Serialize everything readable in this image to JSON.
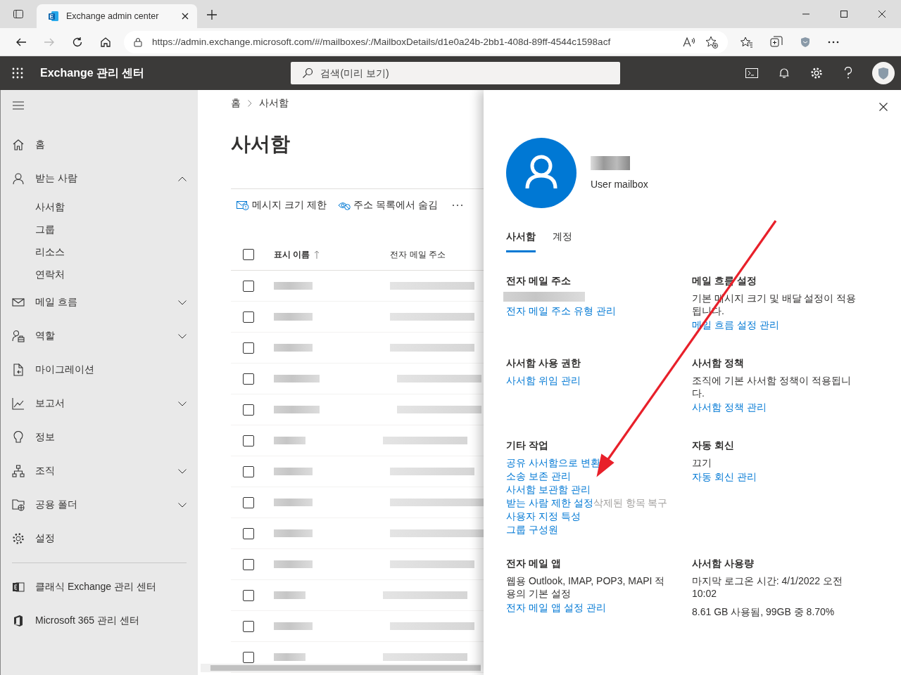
{
  "browser": {
    "tab_title": "Exchange admin center",
    "url": "https://admin.exchange.microsoft.com/#/mailboxes/:/MailboxDetails/d1e0a24b-2bb1-408d-89ff-4544c1598acf"
  },
  "header": {
    "title": "Exchange 관리 센터",
    "search": {
      "placeholder": "검색(미리 보기)"
    }
  },
  "sidebar": {
    "items": [
      {
        "label": "홈"
      },
      {
        "label": "받는 사람",
        "expanded": true,
        "children": [
          {
            "label": "사서함"
          },
          {
            "label": "그룹"
          },
          {
            "label": "리소스"
          },
          {
            "label": "연락처"
          }
        ]
      },
      {
        "label": "메일 흐름",
        "expanded": false
      },
      {
        "label": "역할",
        "expanded": false
      },
      {
        "label": "마이그레이션"
      },
      {
        "label": "보고서",
        "expanded": false
      },
      {
        "label": "정보"
      },
      {
        "label": "조직",
        "expanded": false
      },
      {
        "label": "공용 폴더",
        "expanded": false
      },
      {
        "label": "설정"
      }
    ],
    "footer": [
      {
        "label": "클래식 Exchange 관리 센터"
      },
      {
        "label": "Microsoft 365 관리 센터"
      }
    ]
  },
  "breadcrumb": [
    "홈",
    "사서함"
  ],
  "page_title": "사서함",
  "toolbar": [
    "메시지 크기 제한",
    "주소 목록에서 숨김"
  ],
  "table": {
    "columns": [
      "표시 이름",
      "전자 메일 주소"
    ],
    "header_checked": false,
    "rows": [
      {
        "checked": false
      },
      {
        "checked": false
      },
      {
        "checked": false
      },
      {
        "checked": false
      },
      {
        "checked": false
      },
      {
        "checked": false
      },
      {
        "checked": false
      },
      {
        "checked": false
      },
      {
        "checked": false
      },
      {
        "checked": false
      },
      {
        "checked": false
      },
      {
        "checked": false
      },
      {
        "checked": false
      }
    ]
  },
  "panel": {
    "subtitle": "User mailbox",
    "tabs": [
      {
        "label": "사서함",
        "selected": true
      },
      {
        "label": "계정",
        "selected": false
      }
    ],
    "sections": [
      {
        "title": "전자 메일 주소",
        "items": [
          {
            "kind": "redacted"
          },
          {
            "kind": "links",
            "links": [
              {
                "label": "전자 메일 주소 유형 관리",
                "disabled": false
              }
            ]
          }
        ]
      },
      {
        "title": "메일 흐름 설정",
        "items": [
          {
            "kind": "text",
            "text": "기본 메시지 크기 및 배달 설정이 적용됩니다."
          },
          {
            "kind": "links",
            "links": [
              {
                "label": "메일 흐름 설정 관리",
                "disabled": false
              }
            ]
          }
        ]
      },
      {
        "title": "사서함 사용 권한",
        "items": [
          {
            "kind": "links",
            "links": [
              {
                "label": "사서함 위임 관리",
                "disabled": false
              }
            ]
          }
        ]
      },
      {
        "title": "사서함 정책",
        "items": [
          {
            "kind": "text",
            "text": "조직에 기본 사서함 정책이 적용됩니다."
          },
          {
            "kind": "links",
            "links": [
              {
                "label": "사서함 정책 관리",
                "disabled": false
              }
            ]
          }
        ]
      },
      {
        "title": "기타 작업",
        "items": [
          {
            "kind": "links",
            "links": [
              {
                "label": "공유 사서함으로 변환",
                "disabled": false
              }
            ]
          },
          {
            "kind": "links",
            "links": [
              {
                "label": "소송 보존 관리",
                "disabled": false
              }
            ]
          },
          {
            "kind": "links",
            "links": [
              {
                "label": "사서함 보관함 관리",
                "disabled": false
              }
            ]
          },
          {
            "kind": "links",
            "links": [
              {
                "label": "받는 사람 제한 설정",
                "disabled": false
              },
              {
                "label": "삭제된 항목 복구",
                "disabled": true
              }
            ]
          },
          {
            "kind": "links",
            "links": [
              {
                "label": "사용자 지정 특성",
                "disabled": false
              }
            ]
          },
          {
            "kind": "links",
            "links": [
              {
                "label": "그룹 구성원",
                "disabled": false
              }
            ]
          }
        ]
      },
      {
        "title": "자동 회신",
        "items": [
          {
            "kind": "text",
            "text": "끄기"
          },
          {
            "kind": "links",
            "links": [
              {
                "label": "자동 회신 관리",
                "disabled": false
              }
            ]
          }
        ]
      },
      {
        "title": "전자 메일 앱",
        "items": [
          {
            "kind": "text",
            "text": "웹용 Outlook, IMAP, POP3, MAPI 적용의 기본 설정"
          },
          {
            "kind": "links",
            "links": [
              {
                "label": "전자 메일 앱 설정 관리",
                "disabled": false
              }
            ]
          }
        ]
      },
      {
        "title": "사서함 사용량",
        "items": [
          {
            "kind": "text",
            "text": "마지막 로그온 시간: 4/1/2022 오전 10:02"
          },
          {
            "kind": "text",
            "text": "8.61 GB 사용됨, 99GB 중 8.70%"
          }
        ]
      }
    ]
  }
}
